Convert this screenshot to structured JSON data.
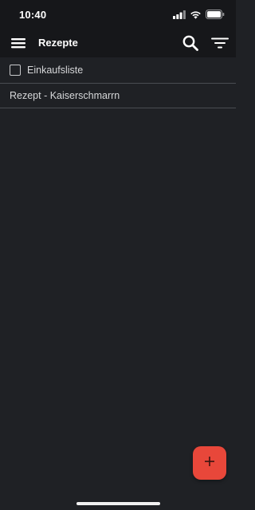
{
  "status_bar": {
    "time": "10:40",
    "icons": [
      "cellular-signal-icon",
      "wifi-icon",
      "battery-icon"
    ]
  },
  "app_bar": {
    "title": "Rezepte",
    "icons": [
      "hamburger-menu-icon",
      "search-icon",
      "filter-icon"
    ]
  },
  "list": {
    "shopping_list_label": "Einkaufsliste",
    "shopping_list_checked": false,
    "items": [
      {
        "label": "Rezept - Kaiserschmarrn"
      }
    ]
  },
  "fab": {
    "icon": "plus-icon"
  },
  "colors": {
    "background": "#1f2125",
    "bar": "#16171a",
    "divider": "#4a4d52",
    "text": "#d6d7d9",
    "accent": "#e8473a"
  }
}
